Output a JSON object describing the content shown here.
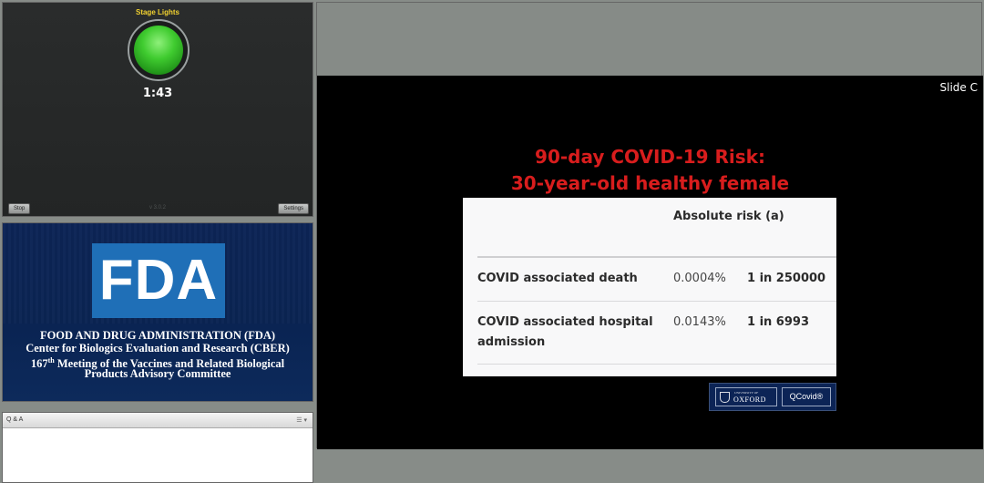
{
  "stage_lights": {
    "title": "Stage Lights",
    "timer": "1:43",
    "stop_label": "Stop",
    "settings_label": "Settings",
    "version": "v 3.0.2",
    "light_color": "#3fcb2f"
  },
  "fda_panel": {
    "logo_text": "FDA",
    "line1": "FOOD AND DRUG ADMINISTRATION (FDA)",
    "line2": "Center for Biologics Evaluation and Research (CBER)",
    "line3_prefix": "167",
    "line3_sup": "th",
    "line3_suffix": " Meeting of the Vaccines and Related Biological",
    "line4": "Products Advisory Committee"
  },
  "qa_panel": {
    "title": "Q & A",
    "menu": "☰ ▾"
  },
  "slide": {
    "label": "Slide C",
    "title_line1": "90-day COVID-19 Risk:",
    "title_line2": "30-year-old healthy female",
    "title_color": "#d81d1d",
    "table": {
      "header": "Absolute risk (a)",
      "rows": [
        {
          "label": "COVID associated death",
          "percent": "0.0004%",
          "ratio": "1 in 250000"
        },
        {
          "label": "COVID associated hospital admission",
          "percent": "0.0143%",
          "ratio": "1 in 6993"
        }
      ]
    },
    "logos": {
      "oxford_small": "UNIVERSITY OF",
      "oxford_big": "OXFORD",
      "qcovid": "QCovid®"
    }
  }
}
